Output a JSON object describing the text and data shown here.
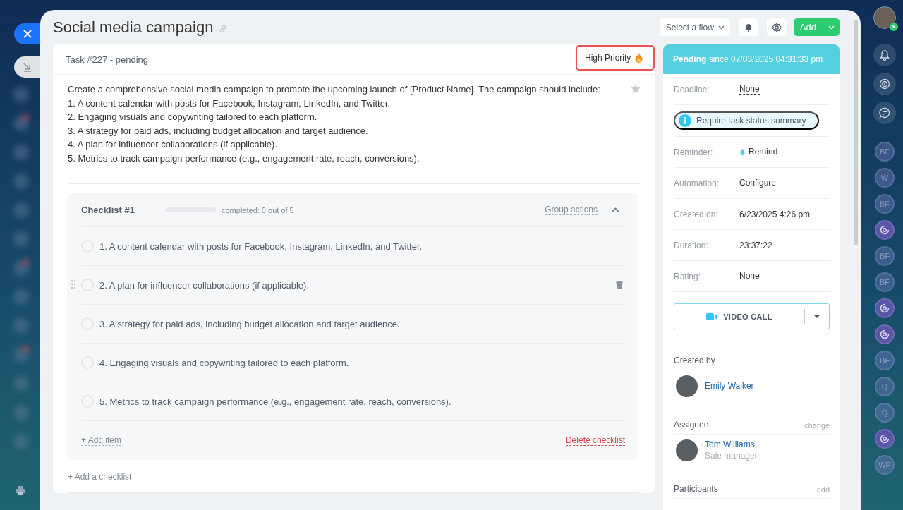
{
  "title": "Social media campaign",
  "header_actions": {
    "flow_select": "Select a flow",
    "add_button": "Add"
  },
  "task": {
    "heading": "Task #227 - pending",
    "priority": "High Priority",
    "starred": false,
    "description": [
      "Create a comprehensive social media campaign to promote the upcoming launch of [Product Name]. The campaign should include:",
      "1. A content calendar with posts for Facebook, Instagram, LinkedIn, and Twitter.",
      "2. Engaging visuals and copywriting tailored to each platform.",
      "3. A strategy for paid ads, including budget allocation and target audience.",
      "4. A plan for influencer collaborations (if applicable).",
      "5. Metrics to track campaign performance (e.g., engagement rate, reach, conversions)."
    ]
  },
  "checklist": {
    "title": "Checklist #1",
    "level": 0,
    "progress_text": "completed: 0 out of 5",
    "group_actions": "Group actions",
    "expanded": true,
    "items": [
      {
        "text": "1. A content calendar with posts for Facebook, Instagram, LinkedIn, and Twitter.",
        "checked": false,
        "hovered": false
      },
      {
        "text": "2. A plan for influencer collaborations (if applicable).",
        "checked": false,
        "hovered": true
      },
      {
        "text": "3. A strategy for paid ads, including budget allocation and target audience.",
        "checked": false,
        "hovered": false
      },
      {
        "text": "4. Engaging visuals and copywriting tailored to each platform.",
        "checked": false,
        "hovered": false
      },
      {
        "text": "5. Metrics to track campaign performance (e.g., engagement rate, reach, conversions).",
        "checked": false,
        "hovered": false
      }
    ],
    "add_item": "+ Add item",
    "delete": "Delete checklist"
  },
  "add_checklist": "+ Add a checklist",
  "status": "**Pending** since 07/03/2025 04:31:33 pm",
  "fields": [
    {
      "kind": "link",
      "label": "Deadline:",
      "value": "None"
    },
    {
      "kind": "notice",
      "text": "Require task status summary"
    },
    {
      "kind": "reminder",
      "label": "Reminder:",
      "value": "Remind"
    },
    {
      "kind": "link",
      "label": "Automation:",
      "value": "Configure"
    },
    {
      "kind": "text",
      "label": "Created on:",
      "value": "6/23/2025 4:26 pm"
    },
    {
      "kind": "text",
      "label": "Duration:",
      "value": "23:37:22"
    },
    {
      "kind": "link",
      "label": "Rating:",
      "value": "None"
    }
  ],
  "video_call": "VIDEO CALL",
  "people": [
    {
      "heading": "Created by",
      "person": {
        "name": "Emily Walker"
      }
    },
    {
      "heading": "Assignee",
      "action": "change",
      "person": {
        "name": "Tom Williams",
        "role": "Sale manager"
      }
    },
    {
      "heading": "Participants",
      "action": "add"
    }
  ],
  "rail": [
    {
      "kind": "initials",
      "text": "BF"
    },
    {
      "kind": "initials",
      "text": "W"
    },
    {
      "kind": "initials",
      "text": "BF"
    },
    {
      "kind": "bot"
    },
    {
      "kind": "initials",
      "text": "BF"
    },
    {
      "kind": "initials",
      "text": "BF"
    },
    {
      "kind": "bot"
    },
    {
      "kind": "bot"
    },
    {
      "kind": "initials",
      "text": "BF"
    },
    {
      "kind": "initials",
      "text": "Q"
    },
    {
      "kind": "initials",
      "text": "Q"
    },
    {
      "kind": "bot"
    },
    {
      "kind": "initials",
      "text": "WP"
    }
  ]
}
